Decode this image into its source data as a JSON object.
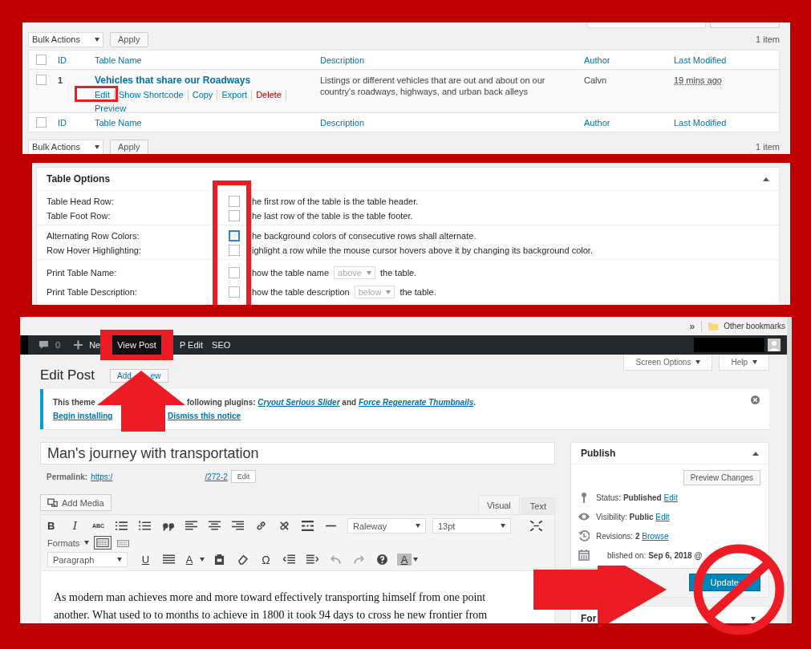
{
  "tables_list": {
    "select_all_checked": false,
    "bulk_actions_top": "Bulk Actions",
    "apply_top": "Apply",
    "count_top": "1 item",
    "columns": [
      "ID",
      "Table Name",
      "Description",
      "Author",
      "Last Modified"
    ],
    "rows": [
      {
        "selected": false,
        "id": "1",
        "name": "Vehicles that share our Roadways",
        "actions": [
          {
            "label": "Edit",
            "kind": "link"
          },
          {
            "label": "Show Shortcode",
            "kind": "link"
          },
          {
            "label": "Copy",
            "kind": "link"
          },
          {
            "label": "Export",
            "kind": "link"
          },
          {
            "label": "Delete",
            "kind": "delete"
          },
          {
            "label": "Preview",
            "kind": "link"
          }
        ],
        "description": "Listings or different vehicles that are out and about on our country's roadways, highways, and urban back alleys",
        "author": "Calvn",
        "modified": "19 mins ago"
      }
    ],
    "footer_columns": [
      "ID",
      "Table Name",
      "Description",
      "Author",
      "Last Modified"
    ],
    "bulk_actions_bottom": "Bulk Actions",
    "apply_bottom": "Apply",
    "count_bottom": "1 item"
  },
  "table_options": {
    "title": "Table Options",
    "groups": [
      [
        {
          "label": "Table Head Row:",
          "checked": false,
          "focused": false,
          "text": "he first row of the table is the table header."
        },
        {
          "label": "Table Foot Row:",
          "checked": false,
          "focused": false,
          "text": "he last row of the table is the table footer."
        }
      ],
      [
        {
          "label": "Alternating Row Colors:",
          "checked": false,
          "focused": true,
          "text": "he background colors of consecutive rows shall alternate."
        },
        {
          "label": "Row Hover Highlighting:",
          "checked": false,
          "focused": false,
          "text": "ighlight a row while the mouse cursor hovers above it by changing its background color."
        }
      ],
      [
        {
          "label": "Print Table Name:",
          "checked": false,
          "focused": false,
          "text": "how the table name",
          "select": "above",
          "text_after": "the table."
        },
        {
          "label": "Print Table Description:",
          "checked": false,
          "focused": false,
          "text": "how the table description",
          "select": "below",
          "text_after": "the table."
        }
      ]
    ]
  },
  "editor": {
    "browser_bar": {
      "overflow": "»",
      "bookmarks_folder": "Other bookmarks"
    },
    "admin_bar": {
      "comments": "0",
      "new": "Ne",
      "view_post": "View Post",
      "wp_edit": "P Edit",
      "seo": "SEO"
    },
    "screen_options": "Screen Options",
    "help": "Help",
    "heading": "Edit Post",
    "add_new": [
      "Add",
      "ew"
    ],
    "notice": {
      "line1_start": "This theme",
      "line1_rest": "following plugins:",
      "plugin_1": "Cryout Serious Slider",
      "joiner": "and",
      "plugin_2": "Force Regenerate Thumbnails",
      "end": ".",
      "link_1": "Begin installing",
      "link_2": "Dismiss this notice"
    },
    "post_title": "Man's journey with transportation",
    "permalink": {
      "label": "Permalink:",
      "url_start": "https:/",
      "url_end": "/272-2",
      "edit": "Edit"
    },
    "add_media": "Add Media",
    "editor_tabs": [
      {
        "label": "Visual",
        "selected": true
      },
      {
        "label": "Text",
        "selected": false
      }
    ],
    "toolbar": {
      "bold": "B",
      "italic": "I",
      "strikethrough": "ABC",
      "font": "Raleway",
      "size": "13pt",
      "formats": "Formats",
      "toolbar_toggle_on": true,
      "block_format": "Paragraph",
      "underline": "U",
      "text_color": "A",
      "special_character": "Ω",
      "background_color": "A"
    },
    "content_lines": [
      "As modern man achieves more and more toward effectively transporting himself from one point",
      "another.  What used to to months to achieve in 1800 it took 94 days to cross he new frontier from"
    ],
    "publish": {
      "title": "Publish",
      "preview": "Preview Changes",
      "rows": [
        {
          "kind": "status",
          "label": "Status:",
          "value": "Published",
          "link": "Edit"
        },
        {
          "kind": "visibility",
          "label": "Visibility:",
          "value": "Public",
          "link": "Edit"
        },
        {
          "kind": "revisions",
          "label": "Revisions:",
          "value": "2",
          "link": "Browse"
        },
        {
          "kind": "schedule",
          "label": "blished on:",
          "value": "Sep 6, 2018 @"
        }
      ],
      "update": "Update"
    },
    "format_box": {
      "title": "For"
    }
  }
}
